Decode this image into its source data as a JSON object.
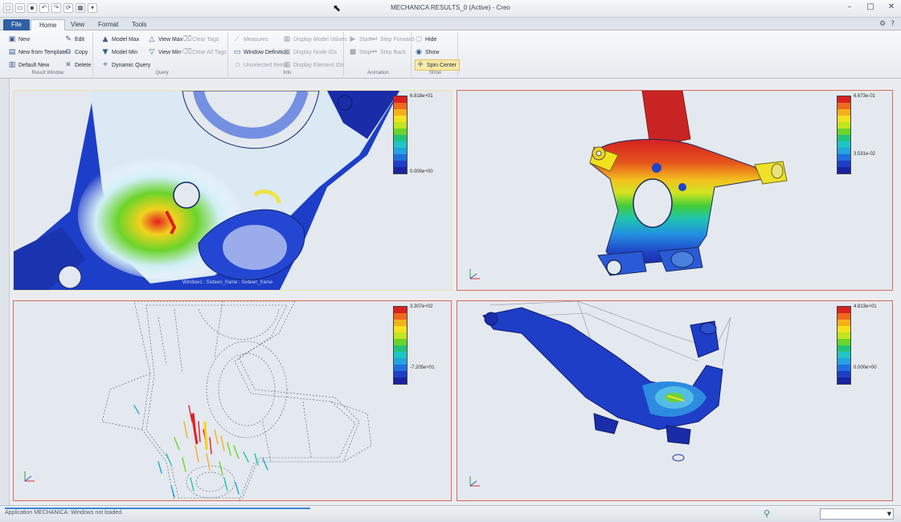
{
  "window": {
    "title": "MECHANICA RESULTS_0 (Active) - Creo"
  },
  "tabs": [
    "File",
    "Home",
    "View",
    "Format",
    "Tools"
  ],
  "ribbon": {
    "groups": [
      {
        "label": "Result Window",
        "buttons": [
          "New",
          "New from Template",
          "Default New",
          "Edit",
          "Copy",
          "Delete"
        ]
      },
      {
        "label": "Query",
        "buttons": [
          "Model Max",
          "Model Min",
          "Dynamic Query",
          "View Max",
          "View Min",
          "Clear Tags",
          "Clear All Tags"
        ]
      },
      {
        "label": "Info",
        "buttons": [
          "Measures",
          "Window Definition",
          "Unselected Items",
          "Display Model Values",
          "Display Node IDs",
          "Display Element IDs"
        ]
      },
      {
        "label": "Animation",
        "buttons": [
          "Start",
          "Step Forward",
          "Stop",
          "Step Back"
        ]
      },
      {
        "label": "Show",
        "buttons": [
          "Hide",
          "Show",
          "Spin Center"
        ]
      }
    ]
  },
  "viewports": [
    {
      "legend_max": "6.818e+01",
      "legend_min": "0.000e+00",
      "caption": "Window1 : Sixteen_frame : Sixteen_frame"
    },
    {
      "legend_max": "6.673e-01",
      "legend_min": "3.531e-02"
    },
    {
      "legend_max": "3.307e+02",
      "legend_min": "-7.205e+01"
    },
    {
      "legend_max": "4.813e+01",
      "legend_min": "0.000e+00"
    }
  ],
  "legend_colors": [
    "#d92020",
    "#ef6a1c",
    "#f4b01c",
    "#f2e21e",
    "#bfe620",
    "#6bd42a",
    "#22c47a",
    "#1fc4c4",
    "#23a3e0",
    "#1f6fe0",
    "#1e3fc8",
    "#1a23a0"
  ],
  "status": {
    "message": "Application MECHANICA: Windows not loaded.",
    "filter": ""
  }
}
